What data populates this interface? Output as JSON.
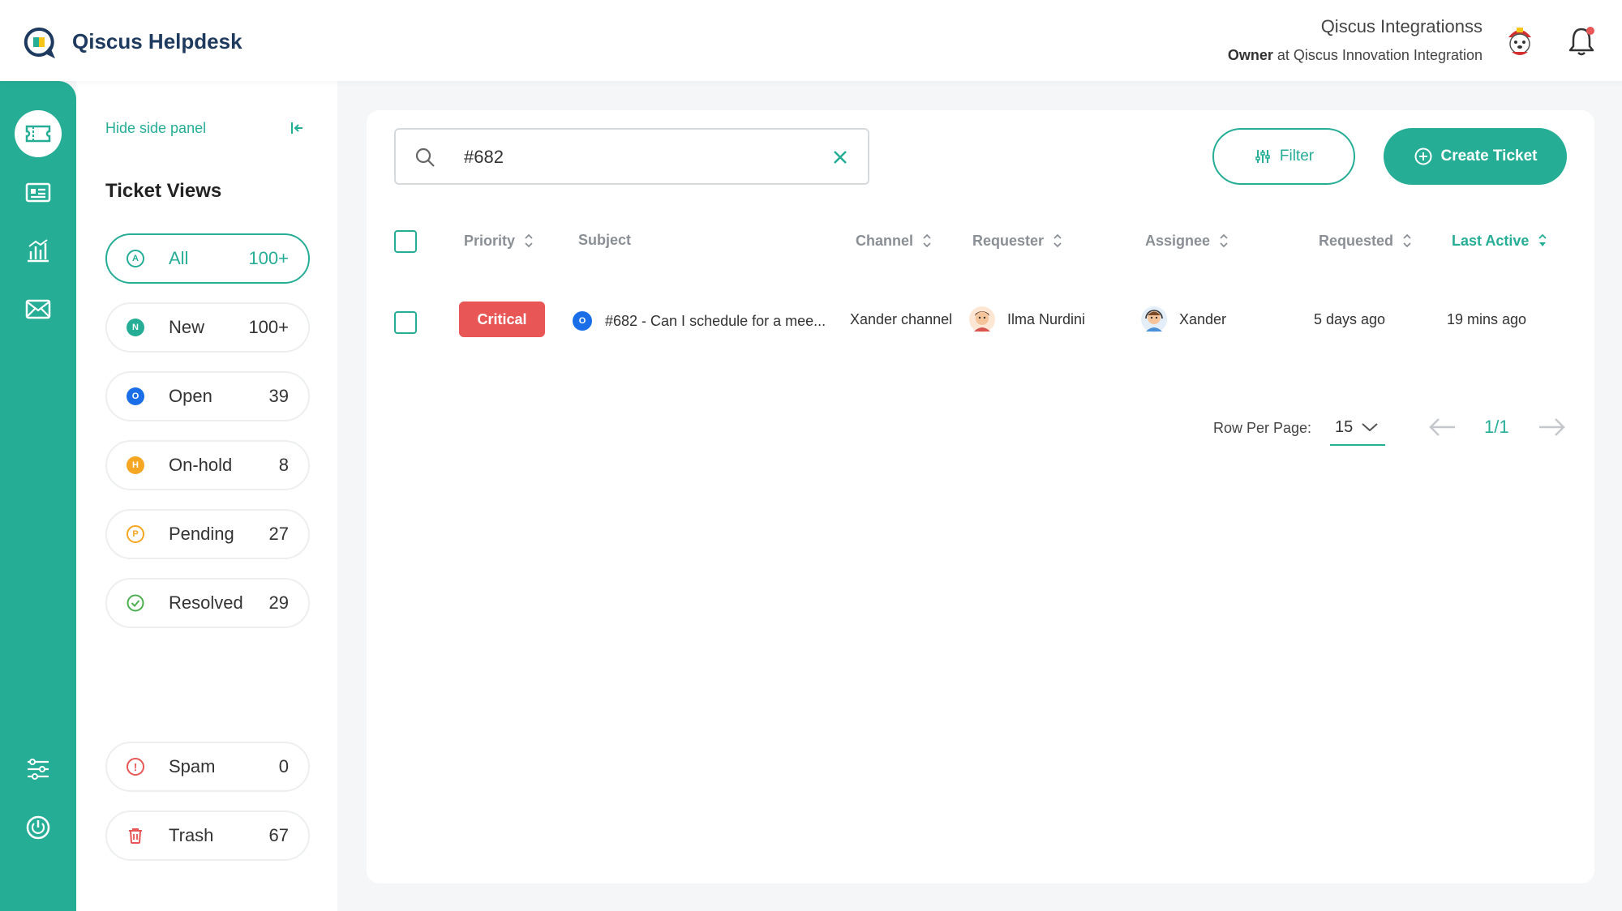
{
  "header": {
    "app_title": "Qiscus Helpdesk",
    "user_name": "Qiscus Integrationss",
    "user_role": "Owner",
    "user_role_at": " at Qiscus Innovation Integration"
  },
  "side_panel": {
    "hide_label": "Hide side panel",
    "views_title": "Ticket Views",
    "views": [
      {
        "label": "All",
        "count": "100+",
        "badge": "A"
      },
      {
        "label": "New",
        "count": "100+",
        "badge": "N"
      },
      {
        "label": "Open",
        "count": "39",
        "badge": "O"
      },
      {
        "label": "On-hold",
        "count": "8",
        "badge": "H"
      },
      {
        "label": "Pending",
        "count": "27",
        "badge": "P"
      },
      {
        "label": "Resolved",
        "count": "29",
        "badge": ""
      },
      {
        "label": "Spam",
        "count": "0",
        "badge": "!"
      },
      {
        "label": "Trash",
        "count": "67",
        "badge": ""
      }
    ]
  },
  "toolbar": {
    "search_value": "#682",
    "filter_label": "Filter",
    "create_label": "Create Ticket"
  },
  "table": {
    "columns": [
      "Priority",
      "Subject",
      "Channel",
      "Requester",
      "Assignee",
      "Requested",
      "Last Active"
    ],
    "rows": [
      {
        "priority": "Critical",
        "status_badge": "O",
        "subject": "#682 - Can I schedule for a mee...",
        "channel": "Xander channel",
        "requester": "Ilma Nurdini",
        "assignee": "Xander",
        "requested": "5 days ago",
        "last_active": "19 mins ago"
      }
    ]
  },
  "pagination": {
    "rows_per_page_label": "Row Per Page:",
    "rows_per_page": "15",
    "page": "1/1"
  },
  "colors": {
    "brand": "#26ad96",
    "critical": "#e85656",
    "open": "#1a6fe8",
    "onhold": "#f5a623",
    "resolved": "#4caf50"
  }
}
